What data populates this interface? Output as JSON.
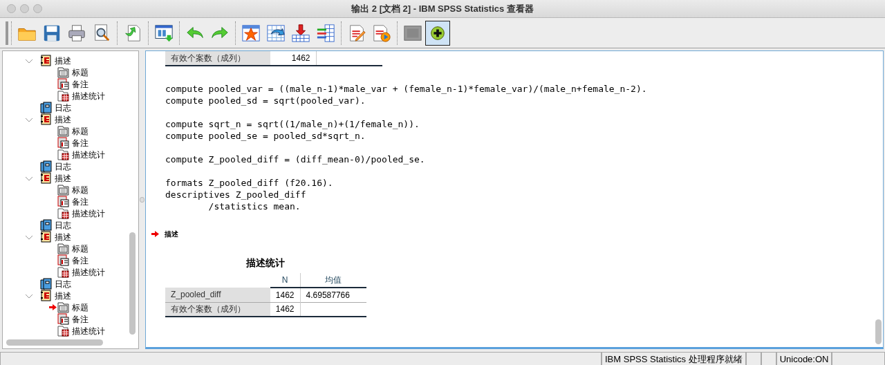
{
  "window": {
    "title": "输出 2 [文档 2] - IBM SPSS Statistics 查看器"
  },
  "toolbar": [
    [
      {
        "kind": "open",
        "pressed": false
      },
      {
        "kind": "save",
        "pressed": false
      },
      {
        "kind": "print",
        "pressed": false
      },
      {
        "kind": "preview",
        "pressed": false
      }
    ],
    [
      {
        "kind": "export",
        "pressed": false
      }
    ],
    [
      {
        "kind": "recall",
        "pressed": false
      }
    ],
    [
      {
        "kind": "undo",
        "pressed": false
      },
      {
        "kind": "redo",
        "pressed": false
      }
    ],
    [
      {
        "kind": "star",
        "pressed": false
      },
      {
        "kind": "goto",
        "pressed": false
      },
      {
        "kind": "insert",
        "pressed": false
      },
      {
        "kind": "variables",
        "pressed": false
      }
    ],
    [
      {
        "kind": "edit",
        "pressed": false
      },
      {
        "kind": "run",
        "pressed": false
      }
    ],
    [
      {
        "kind": "blank",
        "pressed": false
      },
      {
        "kind": "add",
        "pressed": true
      }
    ]
  ],
  "tree": [
    {
      "kind": "group",
      "label": "描述",
      "expanded": true,
      "children": [
        {
          "kind": "title",
          "label": "标题",
          "current": false
        },
        {
          "kind": "note",
          "label": "备注",
          "current": false
        },
        {
          "kind": "table",
          "label": "描述统计",
          "current": false
        }
      ]
    },
    {
      "kind": "log",
      "label": "日志"
    },
    {
      "kind": "group",
      "label": "描述",
      "expanded": true,
      "children": [
        {
          "kind": "title",
          "label": "标题",
          "current": false
        },
        {
          "kind": "note",
          "label": "备注",
          "current": false
        },
        {
          "kind": "table",
          "label": "描述统计",
          "current": false
        }
      ]
    },
    {
      "kind": "log",
      "label": "日志"
    },
    {
      "kind": "group",
      "label": "描述",
      "expanded": true,
      "children": [
        {
          "kind": "title",
          "label": "标题",
          "current": false
        },
        {
          "kind": "note",
          "label": "备注",
          "current": false
        },
        {
          "kind": "table",
          "label": "描述统计",
          "current": false
        }
      ]
    },
    {
      "kind": "log",
      "label": "日志"
    },
    {
      "kind": "group",
      "label": "描述",
      "expanded": true,
      "children": [
        {
          "kind": "title",
          "label": "标题",
          "current": false
        },
        {
          "kind": "note",
          "label": "备注",
          "current": false
        },
        {
          "kind": "table",
          "label": "描述统计",
          "current": false
        }
      ]
    },
    {
      "kind": "log",
      "label": "日志"
    },
    {
      "kind": "group",
      "label": "描述",
      "expanded": true,
      "children": [
        {
          "kind": "title",
          "label": "标题",
          "current": true
        },
        {
          "kind": "note",
          "label": "备注",
          "current": false
        },
        {
          "kind": "table",
          "label": "描述统计",
          "current": false
        }
      ]
    }
  ],
  "output": {
    "previous_table_row": [
      "有效个案数（成列）",
      "1462"
    ],
    "syntax": [
      [
        "compute pooled_var = ((male_n-1)*male_var + (female_n-1)*female_var)/(male_n+female_n-2).",
        "compute pooled_sd = sqrt(pooled_var)."
      ],
      [
        "compute sqrt_n = sqrt((1/male_n)+(1/female_n)).",
        "compute pooled_se = pooled_sd*sqrt_n."
      ],
      [
        "compute Z_pooled_diff = (diff_mean-0)/pooled_se."
      ],
      [
        "formats Z_pooled_diff (f20.16).",
        "descriptives Z_pooled_diff",
        "        /statistics mean."
      ]
    ],
    "heading": {
      "text": "描述",
      "current": true
    },
    "table": {
      "title": "描述统计",
      "columns": [
        "",
        "N",
        "均值"
      ],
      "rows": [
        [
          "Z_pooled_diff",
          "1462",
          "4.69587766"
        ],
        [
          "有效个案数（成列）",
          "1462"
        ]
      ]
    }
  },
  "status_bar": [
    "IBM SPSS Statistics 处理程序就绪",
    "Unicode:ON"
  ]
}
